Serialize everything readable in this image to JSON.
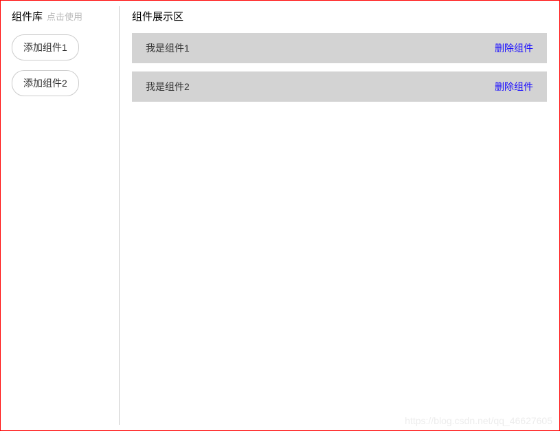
{
  "sidebar": {
    "title": "组件库",
    "hint": "点击使用",
    "buttons": [
      {
        "label": "添加组件1"
      },
      {
        "label": "添加组件2"
      }
    ]
  },
  "main": {
    "title": "组件展示区",
    "items": [
      {
        "label": "我是组件1",
        "deleteLabel": "删除组件"
      },
      {
        "label": "我是组件2",
        "deleteLabel": "删除组件"
      }
    ]
  },
  "watermark": "https://blog.csdn.net/qq_46627605"
}
